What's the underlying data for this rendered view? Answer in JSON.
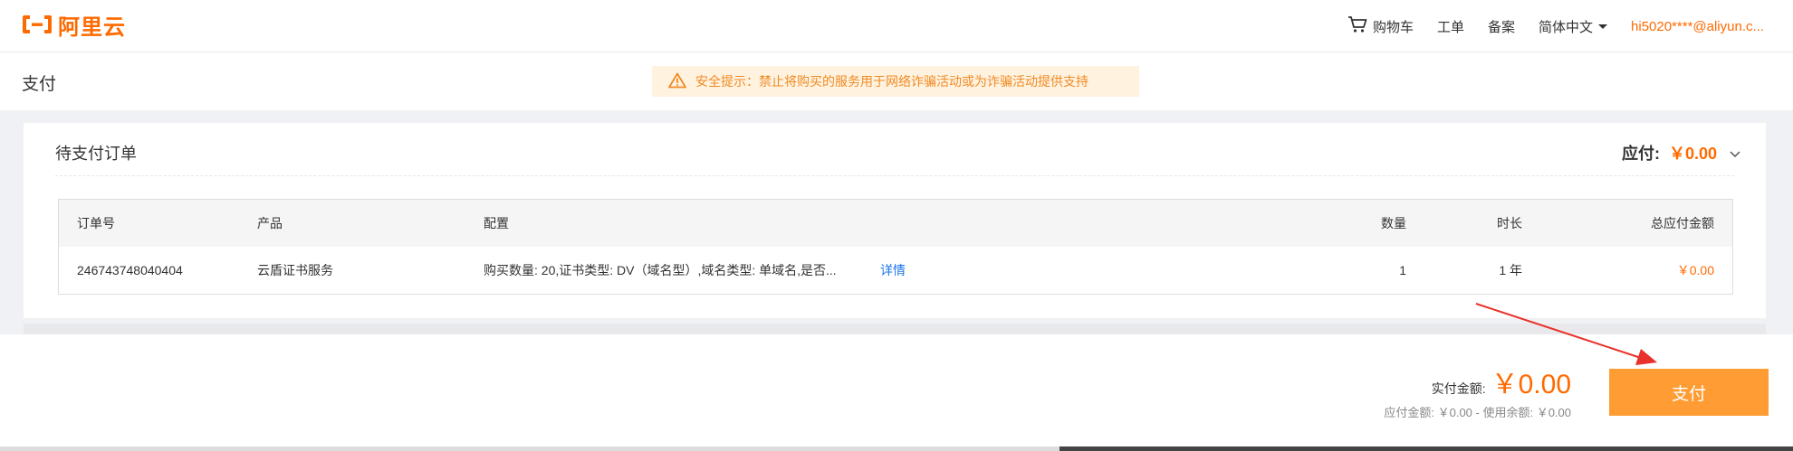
{
  "brand": {
    "name": "阿里云",
    "color": "#ff6a00",
    "icon": "aliyun-logo-icon"
  },
  "nav": {
    "cart": "购物车",
    "ticket": "工单",
    "filing": "备案",
    "language": "简体中文",
    "user": "hi5020****@aliyun.c..."
  },
  "page": {
    "title": "支付"
  },
  "notice": {
    "text": "安全提示：禁止将购买的服务用于网络诈骗活动或为诈骗活动提供支持",
    "icon": "warning-icon"
  },
  "order_card": {
    "title": "待支付订单",
    "due_label": "应付:",
    "due_amount": "￥0.00",
    "columns": {
      "order_no": "订单号",
      "product": "产品",
      "config": "配置",
      "quantity": "数量",
      "duration": "时长",
      "total": "总应付金额"
    },
    "rows": [
      {
        "order_no": "246743748040404",
        "product": "云盾证书服务",
        "config": "购买数量: 20,证书类型: DV（域名型）,域名类型: 单域名,是否...",
        "detail": "详情",
        "quantity": "1",
        "duration": "1 年",
        "total": "￥0.00"
      }
    ]
  },
  "footer": {
    "paid_label": "实付金额:",
    "paid_amount": "￥0.00",
    "breakdown": "应付金额: ￥0.00 - 使用余额: ￥0.00",
    "pay_button": "支付"
  },
  "colors": {
    "accent": "#ff6a00",
    "button": "#ff9c33",
    "notice_bg": "#fff3e0",
    "link": "#1a73e8",
    "annotation": "#e8312a"
  }
}
